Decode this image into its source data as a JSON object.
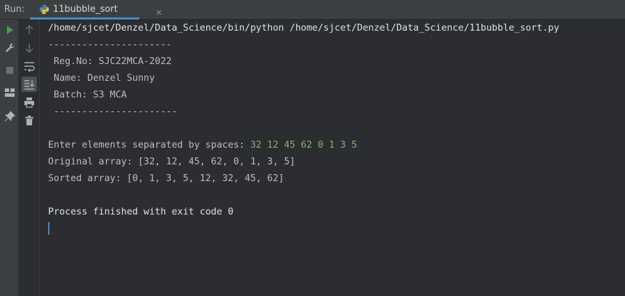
{
  "window": {
    "run_label": "Run:",
    "tab": {
      "title": "11bubble_sort",
      "close_glyph": "×"
    }
  },
  "colors": {
    "accent": "#4a88c7",
    "user_input": "#86b66b",
    "run_green": "#499c54"
  },
  "icons": {
    "toolbar_left": [
      "play-icon",
      "wrench-icon",
      "stop-icon",
      "layout-icon",
      "pin-icon"
    ],
    "toolbar_second": [
      "arrow-up-icon",
      "arrow-down-icon",
      "soft-wrap-icon",
      "scroll-to-end-icon",
      "print-icon",
      "trash-icon"
    ]
  },
  "console": {
    "command": "/home/sjcet/Denzel/Data_Science/bin/python /home/sjcet/Denzel/Data_Science/11bubble_sort.py",
    "divider_top": "----------------------",
    "reg_no": " Reg.No: SJC22MCA-2022",
    "name": " Name: Denzel Sunny",
    "batch": " Batch: S3 MCA",
    "divider_bottom": " ----------------------",
    "prompt": "Enter elements separated by spaces: ",
    "user_input": "32 12 45 62 0 1 3 5",
    "original": "Original array: [32, 12, 45, 62, 0, 1, 3, 5]",
    "sorted": "Sorted array: [0, 1, 3, 5, 12, 32, 45, 62]",
    "exit": "Process finished with exit code 0"
  }
}
